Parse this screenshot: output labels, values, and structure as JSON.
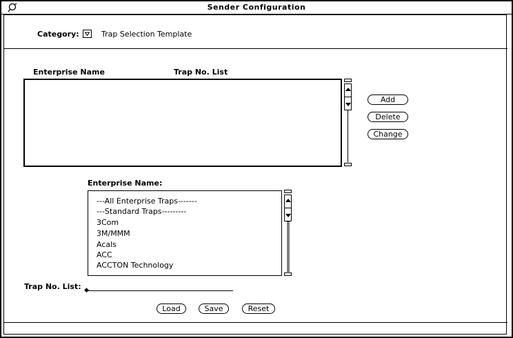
{
  "window": {
    "title": "Sender Configuration",
    "menu_icon": "window-menu-icon"
  },
  "category": {
    "label": "Category:",
    "value": "Trap Selection Template",
    "menu_icon": "menu-triangle-icon"
  },
  "table": {
    "columns": [
      "Enterprise Name",
      "Trap No. List"
    ],
    "rows": []
  },
  "side_buttons": {
    "add": "Add",
    "delete": "Delete",
    "change": "Change"
  },
  "enterprise": {
    "label": "Enterprise Name:",
    "items": [
      "---All Enterprise Traps-------",
      "---Standard Traps---------",
      "3Com",
      "3M/MMM",
      "Acals",
      "ACC",
      "ACCTON Technology"
    ]
  },
  "trap_no": {
    "label": "Trap No. List:",
    "value": ""
  },
  "bottom_buttons": {
    "load": "Load",
    "save": "Save",
    "reset": "Reset"
  }
}
